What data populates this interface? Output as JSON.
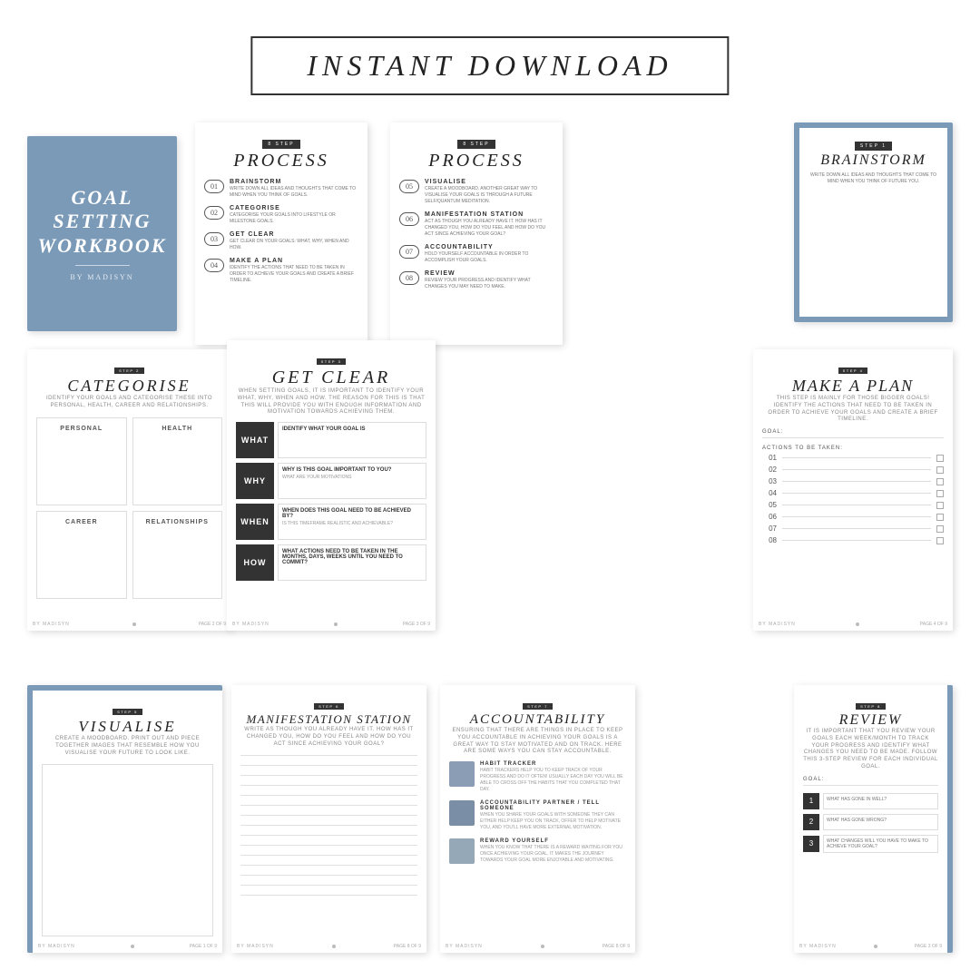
{
  "header": {
    "title": "INSTANT DOWNLOAD"
  },
  "cover": {
    "title": "GOAL\nSETTING\nWORKBOOK",
    "subtitle": "BY MADISYN"
  },
  "process1": {
    "step_badge": "8 STEP",
    "heading": "PROCESS",
    "items": [
      {
        "num": "01",
        "name": "BRAINSTORM",
        "desc": "WRITE DOWN ALL IDEAS AND THOUGHTS THAT COME TO MIND WHEN YOU THINK OF GOALS."
      },
      {
        "num": "02",
        "name": "CATEGORISE",
        "desc": "CATEGORISE YOUR GOALS INTO LIFESTYLE OR MILESTONE GOALS."
      },
      {
        "num": "03",
        "name": "GET CLEAR",
        "desc": "GET CLEAR ON YOUR GOALS: WHAT, WHY, WHEN AND HOW."
      },
      {
        "num": "04",
        "name": "MAKE A PLAN",
        "desc": "IDENTIFY THE ACTIONS THAT NEED TO BE TAKEN IN ORDER TO ACHIEVE YOUR GOALS AND CREATE A BRIEF TIMELINE."
      }
    ]
  },
  "process2": {
    "step_badge": "8 STEP",
    "heading": "PROCESS",
    "items": [
      {
        "num": "05",
        "name": "VISUALISE",
        "desc": "CREATE A MOODBOARD. ANOTHER GREAT WAY TO VISUALISE YOUR GOALS IS THROUGH A FUTURE SELF/QUANTUM MEDITATION."
      },
      {
        "num": "06",
        "name": "MANIFESTATION STATION",
        "desc": "ACT AS THOUGH YOU ALREADY HAVE IT. HOW HAS IT CHANGED YOU, HOW DO YOU FEEL AND HOW DO YOU ACT SINCE ACHIEVING YOUR GOAL?"
      },
      {
        "num": "07",
        "name": "ACCOUNTABILITY",
        "desc": "HOLD YOURSELF ACCOUNTABLE IN ORDER TO ACCOMPLISH YOUR GOALS."
      },
      {
        "num": "08",
        "name": "REVIEW",
        "desc": "REVIEW YOUR PROGRESS AND IDENTIFY WHAT CHANGES YOU MAY NEED TO MAKE."
      }
    ]
  },
  "brainstorm": {
    "step_badge": "STEP 1",
    "heading": "BRAINSTORM",
    "desc": "WRITE DOWN ALL IDEAS AND THOUGHTS THAT COME TO MIND WHEN YOU THINK OF FUTURE YOU."
  },
  "categorise": {
    "step_badge": "STEP 2",
    "heading": "CATEGORISE",
    "desc": "IDENTIFY YOUR GOALS AND CATEGORISE THESE INTO PERSONAL, HEALTH, CAREER AND RELATIONSHIPS.",
    "categories": [
      "PERSONAL",
      "HEALTH",
      "CAREER",
      "RELATIONSHIPS"
    ]
  },
  "get_clear": {
    "step_badge": "STEP 3",
    "heading": "GET CLEAR",
    "desc": "WHEN SETTING GOALS, IT IS IMPORTANT TO IDENTIFY YOUR WHAT, WHY, WHEN AND HOW. THE REASON FOR THIS IS THAT THIS WILL PROVIDE YOU WITH ENOUGH INFORMATION AND MOTIVATION TOWARDS ACHIEVING THEM.",
    "rows": [
      {
        "label": "WHAT",
        "title": "IDENTIFY WHAT YOUR GOAL IS",
        "desc": ""
      },
      {
        "label": "WHY",
        "title": "WHY IS THIS GOAL IMPORTANT TO YOU?",
        "desc": "WHAT ARE YOUR MOTIVATIONS"
      },
      {
        "label": "WHEN",
        "title": "WHEN DOES THIS GOAL NEED TO BE ACHIEVED BY?",
        "desc": "IS THIS TIMEFRAME REALISTIC AND ACHIEVABLE?"
      },
      {
        "label": "HOW",
        "title": "WHAT ACTIONS NEED TO BE TAKEN IN THE MONTHS, DAYS, WEEKS UNTIL YOU NEED TO COMMIT?",
        "desc": ""
      }
    ]
  },
  "make_plan": {
    "step_badge": "STEP 4",
    "heading": "MAKE A PLAN",
    "desc": "THIS STEP IS MAINLY FOR THOSE BIGGER GOALS! IDENTIFY THE ACTIONS THAT NEED TO BE TAKEN IN ORDER TO ACHIEVE YOUR GOALS AND CREATE A BRIEF TIMELINE.",
    "goal_label": "GOAL:",
    "actions_label": "ACTIONS TO BE TAKEN:",
    "rows": [
      "01",
      "02",
      "03",
      "04",
      "05",
      "06",
      "07",
      "08"
    ]
  },
  "visualise": {
    "step_badge": "STEP 5",
    "heading": "VISUALISE",
    "desc": "CREATE A MOODBOARD. PRINT OUT AND PIECE TOGETHER IMAGES THAT RESEMBLE HOW YOU VISUALISE YOUR FUTURE TO LOOK LIKE.",
    "footer_name": "BY MADISYN",
    "footer_page": "PAGE 1 OF 9"
  },
  "manifestation": {
    "step_badge": "STEP 6",
    "heading": "MANIFESTATION STATION",
    "desc": "WRITE AS THOUGH YOU ALREADY HAVE IT. HOW HAS IT CHANGED YOU, HOW DO YOU FEEL AND HOW DO YOU ACT SINCE ACHIEVING YOUR GOAL?",
    "footer_name": "BY MADISYN",
    "footer_page": "PAGE 8 OF 9"
  },
  "accountability": {
    "step_badge": "STEP 7",
    "heading": "ACCOUNTABILITY",
    "desc": "ENSURING THAT THERE ARE THINGS IN PLACE TO KEEP YOU ACCOUNTABLE IN ACHIEVING YOUR GOALS IS A GREAT WAY TO STAY MOTIVATED AND ON TRACK. HERE ARE SOME WAYS YOU CAN STAY ACCOUNTABLE.",
    "items": [
      {
        "title": "HABIT TRACKER",
        "desc": "HABIT TRACKERS HELP YOU TO KEEP TRACK OF YOUR PROGRESS AND DO IT OFTEN! USUALLY EACH DAY YOU WILL BE ABLE TO CROSS OFF THE HABITS THAT YOU COMPLETED THAT DAY."
      },
      {
        "title": "ACCOUNTABILITY PARTNER / TELL SOMEONE",
        "desc": "WHEN YOU SHARE YOUR GOALS WITH SOMEONE THEY CAN EITHER HELP KEEP YOU ON TRACK, OFFER TO HELP MOTIVATE YOU, AND YOU'LL HAVE MORE EXTERNAL MOTIVATION."
      },
      {
        "title": "REWARD YOURSELF",
        "desc": "WHEN YOU KNOW THAT THERE IS A REWARD WAITING FOR YOU ONCE ACHIEVING YOUR GOAL, IT MAKES THE JOURNEY TOWARDS YOUR GOAL MORE ENJOYABLE AND MOTIVATING."
      }
    ]
  },
  "review": {
    "step_badge": "STEP 8",
    "heading": "REVIEW",
    "desc": "IT IS IMPORTANT THAT YOU REVIEW YOUR GOALS EACH WEEK/MONTH TO TRACK YOUR PROGRESS AND IDENTIFY WHAT CHANGES YOU NEED TO BE MADE. FOLLOW THIS 3-STEP REVIEW FOR EACH INDIVIDUAL GOAL.",
    "goal_label": "GOAL:",
    "rows": [
      {
        "num": "1",
        "label": "WHAT HAS GONE IN WELL?"
      },
      {
        "num": "2",
        "label": "WHAT HAS GONE WRONG?"
      },
      {
        "num": "3",
        "label": "WHAT CHANGES WILL YOU HAVE TO MAKE TO ACHIEVE YOUR GOAL?"
      }
    ]
  }
}
